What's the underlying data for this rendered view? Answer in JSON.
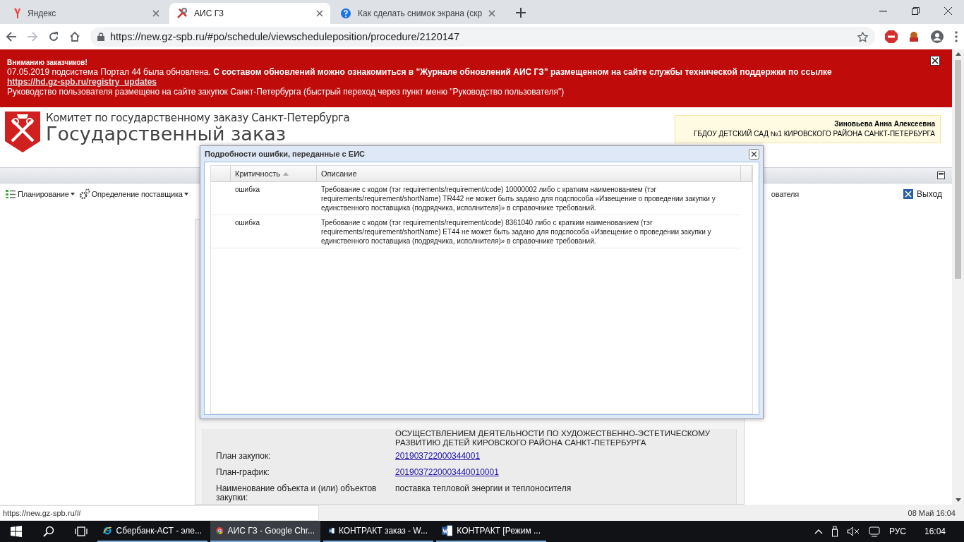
{
  "browser": {
    "tabs": [
      {
        "title": "Яндекс",
        "kind": "yandex",
        "selected": false
      },
      {
        "title": "АИС ГЗ",
        "kind": "tools",
        "selected": true
      },
      {
        "title": "Как сделать снимок экрана (скр",
        "kind": "help",
        "selected": false
      }
    ],
    "url": "https://new.gz-spb.ru/#po/schedule/viewscheduleposition/procedure/2120147"
  },
  "notice": {
    "heading": "Вниманию заказчиков!",
    "message": "07.05.2019 подсистема Портал 44 была обновлена. **С составом обновлений можно ознакомиться в \"Журнале обновлений АИС ГЗ\" размещенном на сайте службы технической поддержки по ссылке**",
    "link": "https://hd.gz-spb.ru/registry_updates",
    "note": "Руководство пользователя размещено на сайте закупок Санкт-Петербурга (быстрый переход через пункт меню \"Руководство пользователя\")"
  },
  "header": {
    "org": "Комитет по государственному заказу Санкт-Петербурга",
    "title": "Государственный заказ",
    "user_name": "Зиновьева Анна Алексеевна",
    "user_org": "ГБДОУ ДЕТСКИЙ САД №1 КИРОВСКОГО РАЙОНА САНКТ-ПЕТЕРБУРГА"
  },
  "menu": [
    {
      "label": "Планирование",
      "kind": "plan",
      "dropdown": true
    },
    {
      "label": "Определение поставщика",
      "kind": "gear",
      "dropdown": true
    },
    {
      "label": "ователя",
      "kind": "plain",
      "dropdown": false
    }
  ],
  "exit": "Выход",
  "record": {
    "continued_value": "ОСУЩЕСТВЛЕНИЕМ ДЕЯТЕЛЬНОСТИ ПО ХУДОЖЕСТВЕННО-ЭСТЕТИЧЕСКОМУ РАЗВИТИЮ ДЕТЕЙ КИРОВСКОГО РАЙОНА САНКТ-ПЕТЕРБУРГА",
    "fields": [
      {
        "label": "План закупок:",
        "value": "201903722000344001",
        "kind": "link"
      },
      {
        "label": "План-график:",
        "value": "2019037220003440010001",
        "kind": "link"
      },
      {
        "label": "Наименование объекта и (или) объектов закупки:",
        "value": "поставка тепловой энергии и теплоносителя",
        "kind": "text"
      }
    ]
  },
  "dialog": {
    "title": "Подробности ошибки, переданные с ЕИС",
    "columns": [
      {
        "label": "Критичность",
        "sorted": true
      },
      {
        "label": "Описание",
        "sorted": false
      }
    ],
    "rows": [
      {
        "severity": "ошибка",
        "description": "Требование с кодом (тэг requirements/requirement/code) 10000002 либо с кратким наименованием (тэг requirements/requirement/shortName) TR442 не может быть задано для подспособа «Извещение о проведении закупки у единственного поставщика (подрядчика, исполнителя)» в справочнике требований."
      },
      {
        "severity": "ошибка",
        "description": "Требование с кодом (тэг requirements/requirement/code) 8361040 либо с кратким наименованием (тэг requirements/requirement/shortName) ET44 не может быть задано для подспособа «Извещение о проведении закупки у единственного поставщика (подрядчика, исполнителя)» в справочнике требований."
      }
    ]
  },
  "status_url": "https://new.gz-spb.ru/#",
  "status_date": "08 Май 16:04",
  "taskbar": {
    "apps": [
      {
        "label": "Сбербанк-АСТ - эле...",
        "kind": "ie",
        "active": false
      },
      {
        "label": "АИС ГЗ - Google Chr...",
        "kind": "chrome",
        "active": true
      },
      {
        "label": "КОНТРАКТ заказ - W...",
        "kind": "word",
        "active": false
      },
      {
        "label": "КОНТРАКТ [Режим ...",
        "kind": "word",
        "active": false
      }
    ],
    "language": "РУС",
    "time": "16:04"
  }
}
